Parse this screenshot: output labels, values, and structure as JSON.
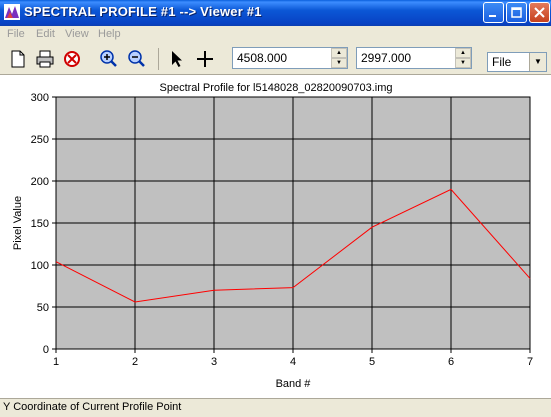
{
  "window": {
    "title": "SPECTRAL PROFILE #1 --> Viewer #1",
    "colors": {
      "titlebar": "#0b57d6",
      "plot_bg": "#c0c0c0",
      "line": "#ff0000"
    }
  },
  "menu": {
    "items": [
      "File",
      "Edit",
      "View",
      "Help"
    ]
  },
  "toolbar": {
    "icons": [
      "new-icon",
      "print-icon",
      "clear-icon",
      "zoom-in-icon",
      "zoom-out-icon",
      "pointer-icon",
      "crosshair-icon"
    ],
    "x_coord": "4508.000",
    "y_coord": "2997.000",
    "output_select": "File"
  },
  "chart_data": {
    "type": "line",
    "title": "Spectral Profile for l5148028_02820090703.img",
    "xlabel": "Band #",
    "ylabel": "Pixel Value",
    "x": [
      1,
      2,
      3,
      4,
      5,
      6,
      7
    ],
    "values": [
      104,
      56,
      70,
      73,
      145,
      190,
      84
    ],
    "xlim": [
      1,
      7
    ],
    "ylim": [
      0,
      300
    ],
    "xticks": [
      "1",
      "2",
      "3",
      "4",
      "5",
      "6",
      "7"
    ],
    "yticks": [
      "0",
      "50",
      "100",
      "150",
      "200",
      "250",
      "300"
    ],
    "grid": true
  },
  "status": {
    "text": "Y Coordinate of Current Profile Point"
  }
}
